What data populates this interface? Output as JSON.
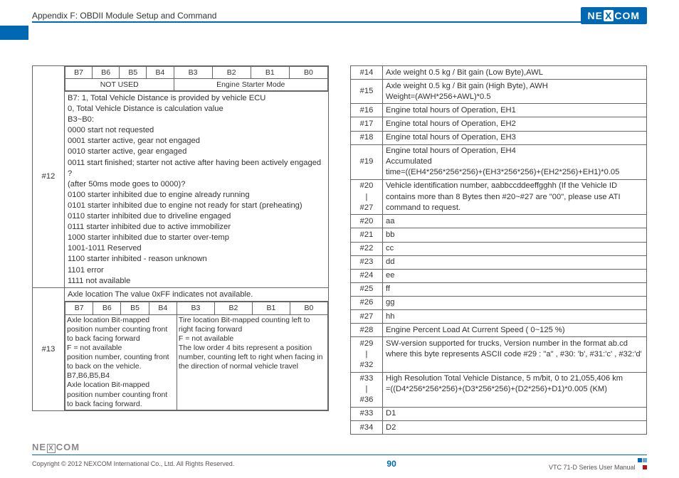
{
  "header": {
    "appendix": "Appendix F: OBDII Module Setup and Command",
    "logo_pre": "NE",
    "logo_x": "X",
    "logo_post": "COM"
  },
  "bits": [
    "B7",
    "B6",
    "B5",
    "B4",
    "B3",
    "B2",
    "B1",
    "B0"
  ],
  "row12": {
    "id": "#12",
    "not_used": "NOT USED",
    "engine_starter_mode": "Engine Starter Mode",
    "lines": [
      "B7: 1, Total Vehicle Distance is provided by vehicle ECU",
      "0, Total Vehicle Distance is calculation value",
      "B3~B0:",
      "0000 start not requested",
      "0001 starter active, gear not engaged",
      "0010 starter active, gear engaged",
      "0011 start finished; starter not active after having been actively engaged ?",
      "(after 50ms mode goes to 0000)?",
      "0100 starter inhibited due to engine already running",
      "0101 starter inhibited due to engine not ready for start (preheating)",
      "0110 starter inhibited due to driveline engaged",
      "0111 starter inhibited due to active immobilizer",
      "1000 starter inhibited due to starter over-temp",
      "1001-1011 Reserved",
      "1100 starter inhibited - reason unknown",
      "1101 error",
      "1111 not available"
    ]
  },
  "row13": {
    "id": "#13",
    "intro": "Axle location The value 0xFF indicates not available.",
    "leftcol": "Axle location Bit-mapped position number counting front to back facing forward\nF = not available\nposition number, counting front to back on the vehicle. B7,B6,B5,B4\nAxle location Bit-mapped position number counting front to back facing forward.",
    "rightcol": "Tire location Bit-mapped counting left to right facing forward\nF = not available\nThe low order 4 bits represent a position number, counting left to right when facing in the direction of normal vehicle travel"
  },
  "right_rows": [
    {
      "id": "#14",
      "txt": "Axle weight 0.5 kg / Bit gain (Low Byte),AWL"
    },
    {
      "id": "#15",
      "txt": "Axle weight 0.5 kg / Bit gain (High Byte), AWH\nWeight=(AWH*256+AWL)*0.5"
    },
    {
      "id": "#16",
      "txt": "Engine total hours of Operation, EH1"
    },
    {
      "id": "#17",
      "txt": "Engine total hours of Operation, EH2"
    },
    {
      "id": "#18",
      "txt": "Engine total hours of Operation, EH3"
    },
    {
      "id": "#19",
      "txt": "Engine total hours of Operation, EH4\nAccumulated\ntime=((EH4*256*256*256)+(EH3*256*256)+(EH2*256)+EH1)*0.05"
    },
    {
      "id": "#20\n|\n#27",
      "txt": "Vehicle identification number, aabbccddeeffgghh (If the Vehicle ID contains more than 8 Bytes then #20~#27 are \"00\", please use ATI command to request."
    },
    {
      "id": "#20",
      "txt": "aa"
    },
    {
      "id": "#21",
      "txt": "bb"
    },
    {
      "id": "#22",
      "txt": "cc"
    },
    {
      "id": "#23",
      "txt": "dd"
    },
    {
      "id": "#24",
      "txt": "ee"
    },
    {
      "id": "#25",
      "txt": "ff"
    },
    {
      "id": "#26",
      "txt": "gg"
    },
    {
      "id": "#27",
      "txt": "hh"
    },
    {
      "id": "#28",
      "txt": "Engine Percent Load At Current Speed ( 0~125 %)"
    },
    {
      "id": "#29\n|\n#32",
      "txt": "SW-version supported for trucks, Version number in the format ab.cd where this byte represents ASCII code #29 : \"a\" , #30: 'b', #31:'c' , #32:'d'"
    },
    {
      "id": "#33\n|\n#36",
      "txt": "High Resolution Total Vehicle Distance, 5 m/bit, 0 to 21,055,406 km\n=((D4*256*256*256)+(D3*256*256)+(D2*256)+D1)*0.005 (KM)"
    },
    {
      "id": "#33",
      "txt": "D1"
    },
    {
      "id": "#34",
      "txt": "D2"
    }
  ],
  "footer": {
    "logo_pre": "NE",
    "logo_x": "X",
    "logo_post": "COM",
    "copyright": "Copyright © 2012 NEXCOM International Co., Ltd. All Rights Reserved.",
    "page": "90",
    "manual": "VTC 71-D Series User Manual"
  }
}
